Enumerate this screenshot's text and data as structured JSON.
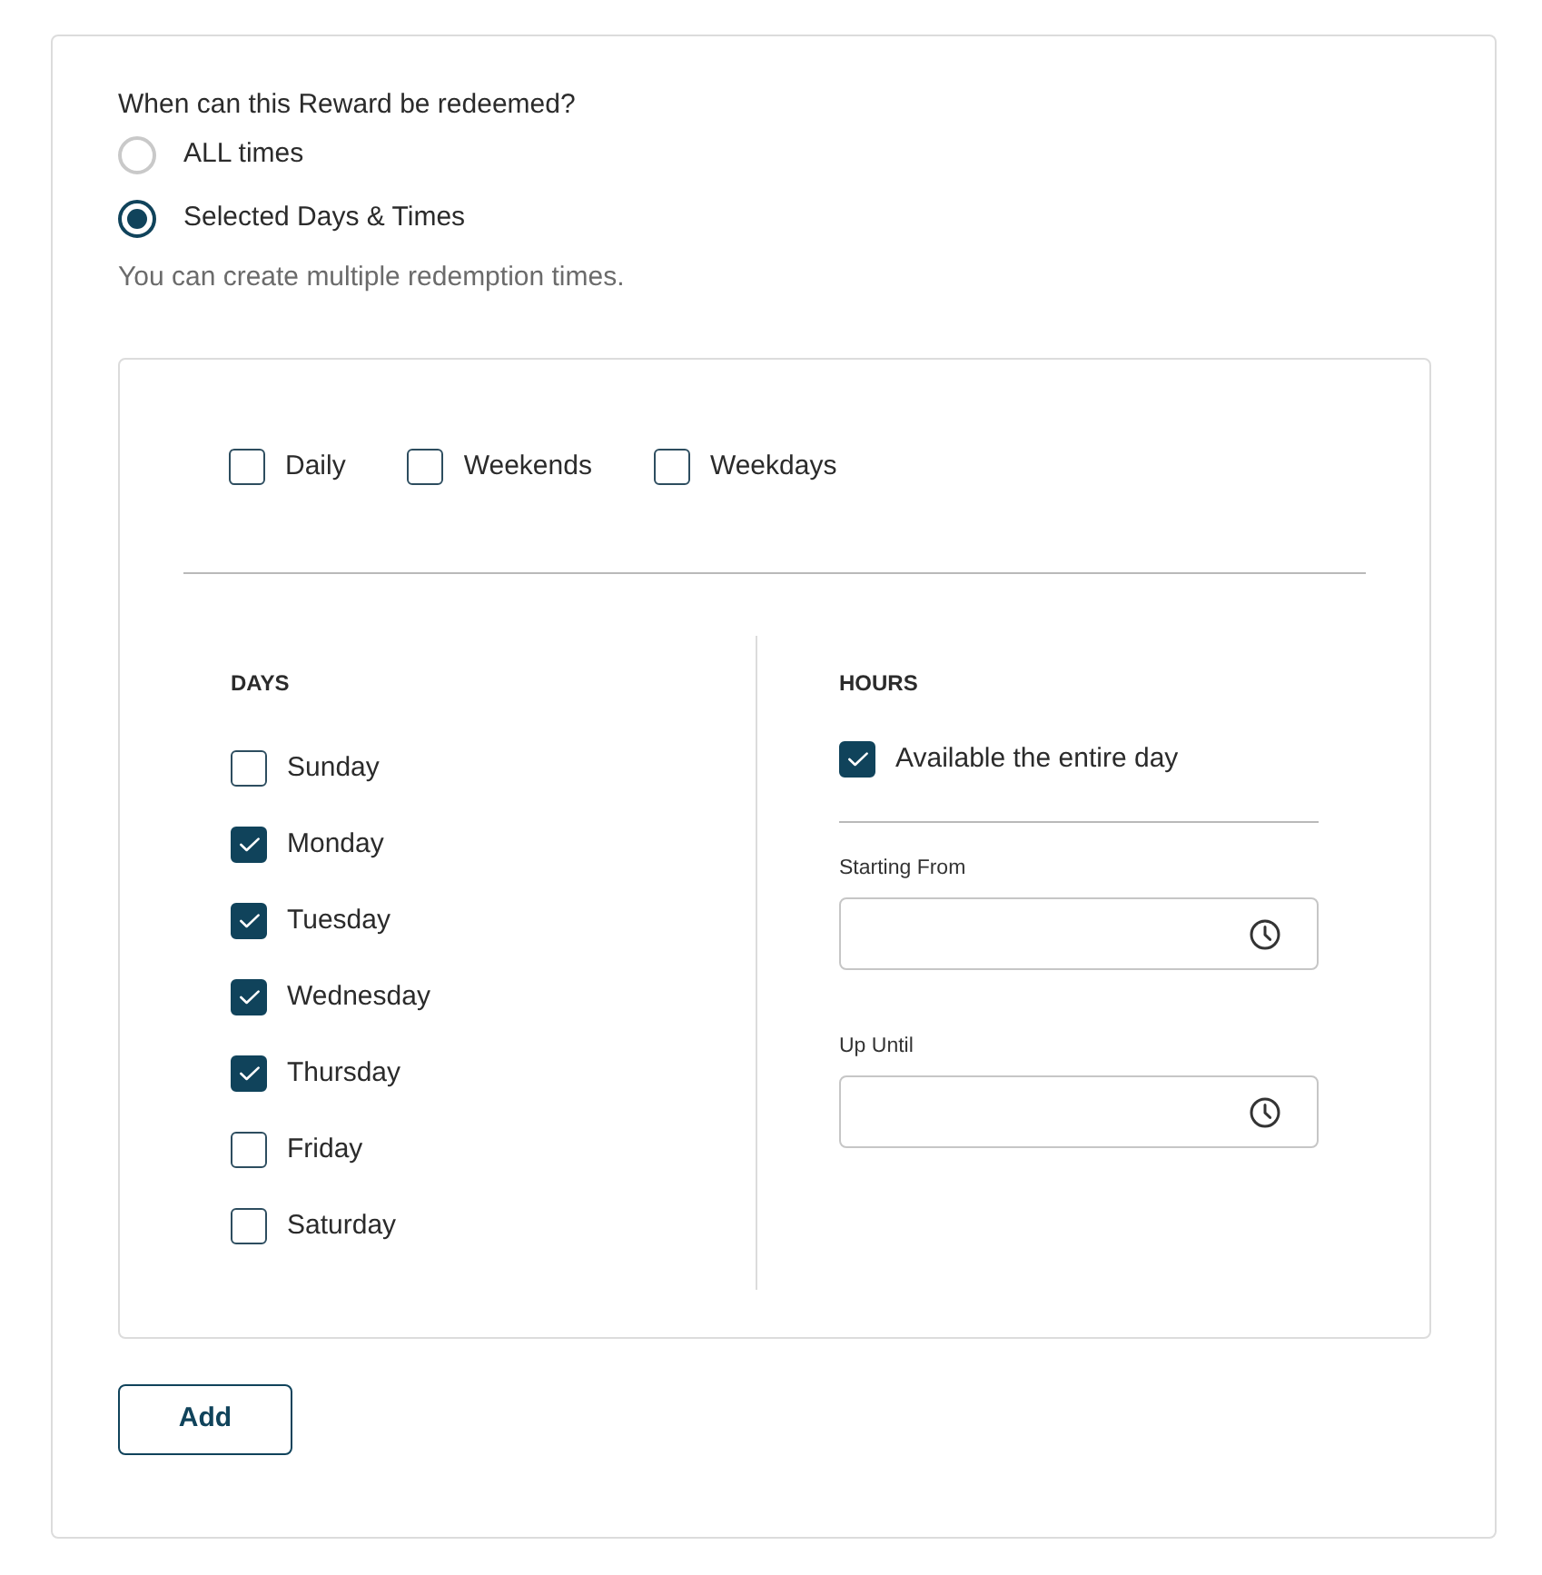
{
  "question": "When can this Reward be redeemed?",
  "options": [
    {
      "label": "ALL times",
      "selected": false
    },
    {
      "label": "Selected Days & Times",
      "selected": true
    }
  ],
  "help_text": "You can create multiple redemption times.",
  "presets": [
    {
      "label": "Daily",
      "checked": false
    },
    {
      "label": "Weekends",
      "checked": false
    },
    {
      "label": "Weekdays",
      "checked": false
    }
  ],
  "days": {
    "heading": "DAYS",
    "items": [
      {
        "label": "Sunday",
        "checked": false
      },
      {
        "label": "Monday",
        "checked": true
      },
      {
        "label": "Tuesday",
        "checked": true
      },
      {
        "label": "Wednesday",
        "checked": true
      },
      {
        "label": "Thursday",
        "checked": true
      },
      {
        "label": "Friday",
        "checked": false
      },
      {
        "label": "Saturday",
        "checked": false
      }
    ]
  },
  "hours": {
    "heading": "HOURS",
    "entire_day": {
      "label": "Available the entire day",
      "checked": true
    },
    "fields": [
      {
        "label": "Starting From"
      },
      {
        "label": "Up Until"
      }
    ]
  },
  "add_button": "Add"
}
